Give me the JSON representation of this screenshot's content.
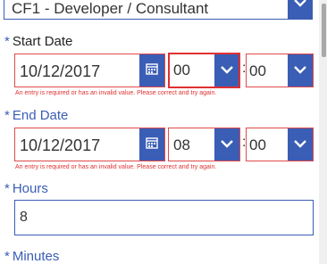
{
  "role_dropdown": {
    "value": "CF1 - Developer / Consultant"
  },
  "start_date": {
    "required_marker": "*",
    "label": "Start Date",
    "date_value": "10/12/2017",
    "hour_value": "00",
    "minute_value": "00",
    "separator": ":",
    "error": "An entry is required or has an invalid value. Please correct and try again."
  },
  "end_date": {
    "required_marker": "*",
    "label": "End Date",
    "date_value": "10/12/2017",
    "hour_value": "08",
    "minute_value": "00",
    "separator": ":",
    "error": "An entry is required or has an invalid value. Please correct and try again."
  },
  "hours": {
    "required_marker": "*",
    "label": "Hours",
    "value": "8"
  },
  "minutes": {
    "required_marker": "*",
    "label": "Minutes"
  },
  "icons": {
    "dropdown": "chevron-down-icon",
    "calendar": "calendar-icon"
  },
  "colors": {
    "accent": "#3a5db5",
    "error": "#e03030",
    "text": "#333333"
  }
}
